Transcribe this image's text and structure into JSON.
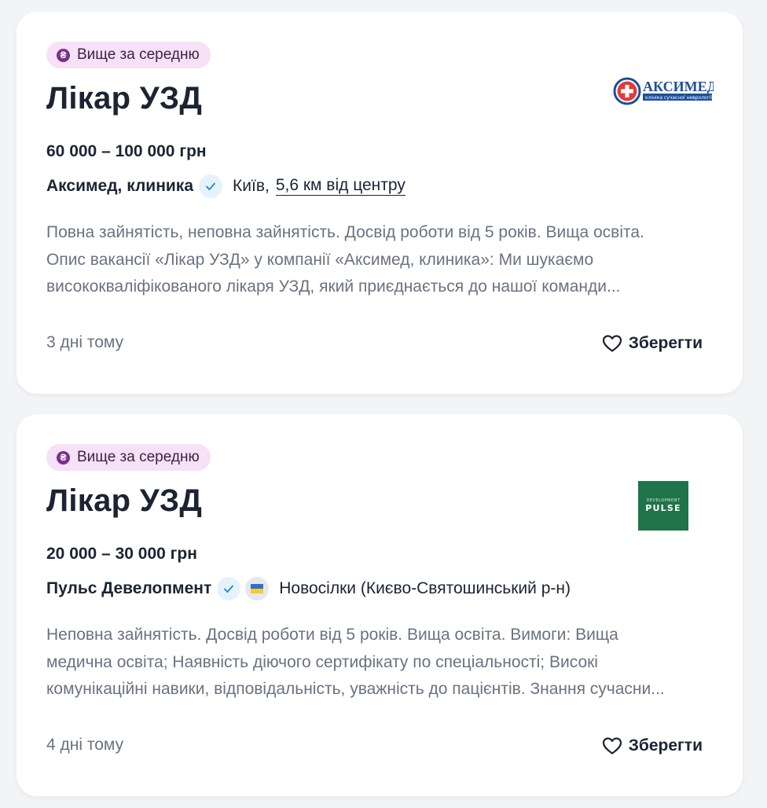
{
  "vacancies": [
    {
      "badge": "Вище за середню",
      "badge_icon": "hryvnia-icon",
      "title": "Лікар УЗД",
      "salary": "60 000 – 100 000 грн",
      "company": "Аксимед, клиника",
      "verified": true,
      "city": "Київ,",
      "distance": "5,6 км від центру",
      "description_lines": [
        "Повна зайнятість, неповна зайнятість. Досвід роботи від 5 років. Вища освіта.",
        "Опис вакансії «Лікар УЗД» у компанії «Аксимед, клиника»: Ми шукаємо",
        "висококваліфікованого лікаря УЗД, який приєднається до нашої команди..."
      ],
      "posted": "3 дні тому",
      "save_label": "Зберегти",
      "logo": {
        "name": "aksimed-logo",
        "brand_text": "АКСИМЕД",
        "tagline": "клініка сучасної неврології",
        "color": "#1d4f9a"
      }
    },
    {
      "badge": "Вище за середню",
      "badge_icon": "hryvnia-icon",
      "title": "Лікар УЗД",
      "salary": "20 000 – 30 000 грн",
      "company": "Пульс Девелопмент",
      "verified": true,
      "ukraine_flag": true,
      "city": "Новосілки (Києво-Святошинський р-н)",
      "description_lines": [
        "Неповна зайнятість. Досвід роботи від 5 років. Вища освіта. Вимоги: Вища",
        "медична освіта; Наявність діючого сертифікату по спеціальності; Високі",
        "комунікаційні навики, відповідальність, уважність до пацієнтів. Знання сучасни..."
      ],
      "posted": "4 дні тому",
      "save_label": "Зберегти",
      "logo": {
        "name": "pulse-logo",
        "small_text": "DEVELOPMENT",
        "brand_text": "PULSE",
        "color": "#1f7449"
      }
    }
  ],
  "colors": {
    "page_bg": "#f3f4f6",
    "card_bg": "#ffffff",
    "badge_bg": "#f6e1f6",
    "badge_icon": "#7a2f8a",
    "text_primary": "#1c2333",
    "text_secondary": "#6b7280",
    "verify_bg": "#e6f2fb",
    "verify_check": "#2b8fd6"
  }
}
